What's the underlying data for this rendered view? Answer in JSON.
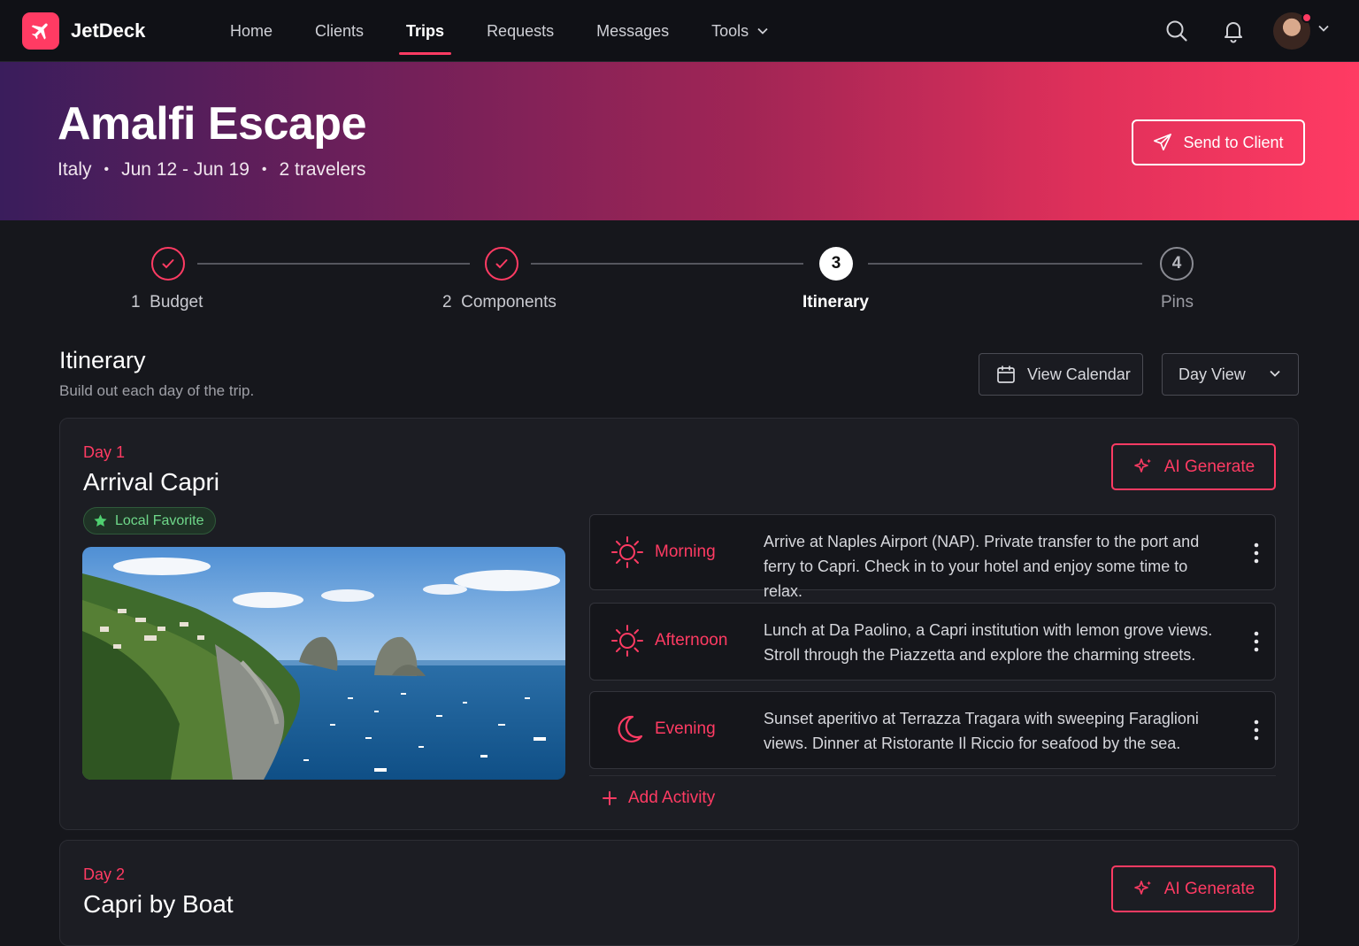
{
  "app": {
    "brand": "JetDeck",
    "accent": "#ff3b63",
    "nav": [
      {
        "label": "Home",
        "active": false
      },
      {
        "label": "Clients",
        "active": false
      },
      {
        "label": "Trips",
        "active": true
      },
      {
        "label": "Requests",
        "active": false
      },
      {
        "label": "Messages",
        "active": false
      },
      {
        "label": "Tools",
        "active": false
      }
    ],
    "icons": [
      "search-icon",
      "bell-icon",
      "avatar",
      "chevron-down-icon"
    ]
  },
  "trip": {
    "title": "Amalfi Escape",
    "country": "Italy",
    "dates": "Jun 12 - Jun 19",
    "travelers": "2 travelers",
    "send_label": "Send to Client"
  },
  "steps": [
    {
      "number": "1",
      "label": "Budget",
      "state": "done"
    },
    {
      "number": "2",
      "label": "Components",
      "state": "done"
    },
    {
      "number": "3",
      "label": "Itinerary",
      "state": "current"
    },
    {
      "number": "4",
      "label": "Pins",
      "state": "todo"
    }
  ],
  "itinerary": {
    "title": "Itinerary",
    "subtitle": "Build out each day of the trip.",
    "view_calendar": "View Calendar",
    "day_view": "Day View"
  },
  "days": [
    {
      "day_label": "Day 1",
      "title": "Arrival Capri",
      "badge": "Local Favorite",
      "ai_label": "AI Generate",
      "activities": [
        {
          "time": "Morning",
          "icon": "sun-icon",
          "text": "Arrive at Naples Airport (NAP). Private transfer to the port and ferry to Capri. Check in to your hotel and enjoy some time to relax."
        },
        {
          "time": "Afternoon",
          "icon": "sun-icon",
          "text": "Lunch at Da Paolino, a Capri institution with lemon grove views. Stroll through the Piazzetta and explore the charming streets."
        },
        {
          "time": "Evening",
          "icon": "moon-icon",
          "text": "Sunset aperitivo at Terrazza Tragara with sweeping Faraglioni views. Dinner at Ristorante Il Riccio for seafood by the sea."
        }
      ],
      "add_label": "Add Activity"
    },
    {
      "day_label": "Day 2",
      "title": "Capri by Boat",
      "ai_label": "AI Generate"
    }
  ]
}
